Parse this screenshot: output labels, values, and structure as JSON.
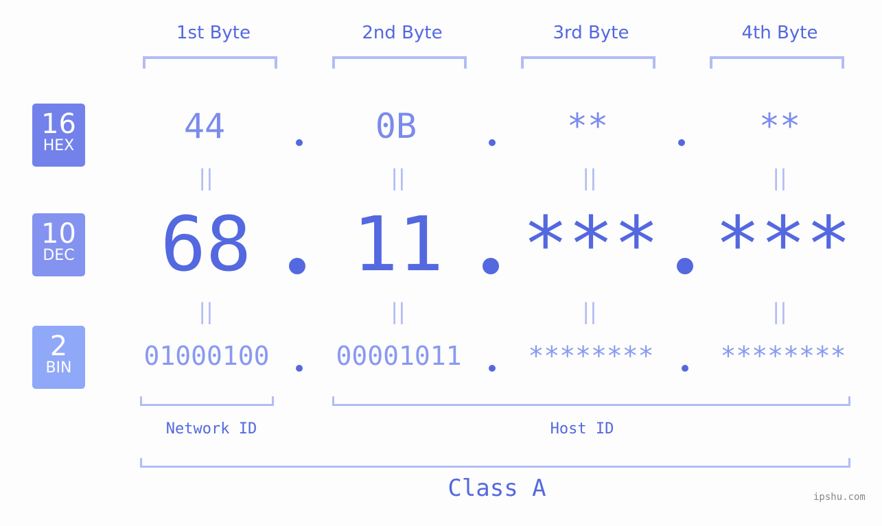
{
  "bytes": [
    {
      "header": "1st Byte",
      "hex": "44",
      "dec": "68",
      "bin": "01000100"
    },
    {
      "header": "2nd Byte",
      "hex": "0B",
      "dec": "11",
      "bin": "00001011"
    },
    {
      "header": "3rd Byte",
      "hex": "**",
      "dec": "***",
      "bin": "********"
    },
    {
      "header": "4th Byte",
      "hex": "**",
      "dec": "***",
      "bin": "********"
    }
  ],
  "bases": [
    {
      "num": "16",
      "label": "HEX",
      "color": "#7381ea"
    },
    {
      "num": "10",
      "label": "DEC",
      "color": "#8493ef"
    },
    {
      "num": "2",
      "label": "BIN",
      "color": "#90a8f8"
    }
  ],
  "equals_sign": "||",
  "network_label": "Network ID",
  "host_label": "Host ID",
  "class_label": "Class A",
  "watermark": "ipshu.com",
  "colors": {
    "accent": "#5468e0",
    "bracket": "#b3bcf5"
  }
}
